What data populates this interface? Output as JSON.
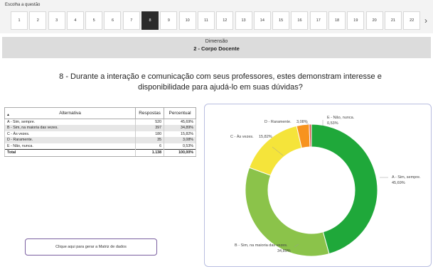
{
  "nav": {
    "label": "Escolha a questão",
    "questions": [
      "1",
      "2",
      "3",
      "4",
      "5",
      "6",
      "7",
      "8",
      "9",
      "10",
      "11",
      "12",
      "13",
      "14",
      "15",
      "16",
      "17",
      "18",
      "19",
      "20",
      "21",
      "22"
    ],
    "active": "8"
  },
  "dimension": {
    "label": "Dimensão",
    "name": "2 - Corpo Docente"
  },
  "question": {
    "text": "8 - Durante a interação e comunicação com seus professores, estes demonstram interesse e disponibilidade para ajudá-lo em suas dúvidas?"
  },
  "table": {
    "headers": [
      "Alternativa",
      "Respostas",
      "Percentual"
    ],
    "rows": [
      {
        "alt": "A - Sim, sempre.",
        "resp": "520",
        "pct": "45,69%"
      },
      {
        "alt": "B - Sim, na maioria das vezes.",
        "resp": "397",
        "pct": "34,89%"
      },
      {
        "alt": "C - Às vezes.",
        "resp": "180",
        "pct": "15,82%"
      },
      {
        "alt": "D - Raramente.",
        "resp": "35",
        "pct": "3,08%"
      },
      {
        "alt": "E - Não, nunca.",
        "resp": "6",
        "pct": "0,53%"
      }
    ],
    "total": {
      "alt": "Total",
      "resp": "1.138",
      "pct": "100,00%"
    }
  },
  "matrix_button": {
    "label": "Clique aqui para gerar a Matriz de dados"
  },
  "chart_data": {
    "type": "pie",
    "donut": true,
    "series": [
      {
        "label": "A - Sim, sempre.",
        "pct_label": "45,69%",
        "value": 45.69,
        "color": "#1fa83a"
      },
      {
        "label": "B - Sim, na maioria das vezes.",
        "pct_label": "34,89%",
        "value": 34.89,
        "color": "#8bc34a"
      },
      {
        "label": "C - Às vezes.",
        "pct_label": "15,82%",
        "value": 15.82,
        "color": "#f5e43a"
      },
      {
        "label": "D - Raramente.",
        "pct_label": "3,08%",
        "value": 3.08,
        "color": "#f7931e"
      },
      {
        "label": "E - Não, nunca.",
        "pct_label": "0,53%",
        "value": 0.53,
        "color": "#d9534f"
      }
    ]
  }
}
